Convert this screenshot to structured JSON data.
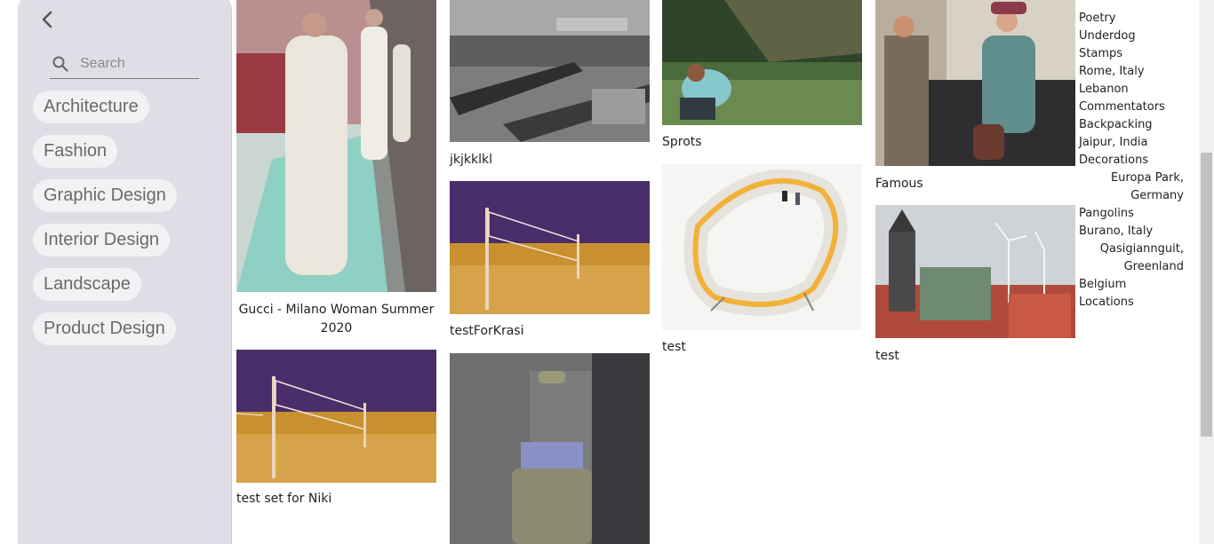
{
  "sidebar": {
    "search_placeholder": "Search",
    "categories": [
      {
        "label": "Architecture"
      },
      {
        "label": "Fashion"
      },
      {
        "label": "Graphic Design"
      },
      {
        "label": "Interior Design"
      },
      {
        "label": "Landscape"
      },
      {
        "label": "Product Design"
      }
    ]
  },
  "cards": {
    "gucci": {
      "caption": "Gucci - Milano Woman Summer 2020"
    },
    "test_set_niki": {
      "caption": "test set for Niki"
    },
    "jkjkklkl": {
      "caption": "jkjkklkl"
    },
    "testforkrasi": {
      "caption": "testForKrasi"
    },
    "sprots": {
      "caption": "Sprots"
    },
    "test_shelf": {
      "caption": "test"
    },
    "famous": {
      "caption": "Famous"
    },
    "test_town": {
      "caption": "test"
    }
  },
  "list": {
    "items": [
      "Poetry",
      "Underdog",
      "Stamps",
      "Rome, Italy",
      "Lebanon",
      "Commentators",
      "Backpacking",
      "Jaipur, India",
      "Decorations",
      "Europa Park,",
      "Germany",
      "Pangolins",
      "Burano, Italy",
      "Qasigiannguit,",
      "Greenland",
      "Belgium",
      "Locations"
    ]
  },
  "icons": {
    "back": "chevron-left-icon",
    "search": "search-icon"
  },
  "colors": {
    "sidebar_bg": "#e1dde6",
    "chip_bg": "#f3f1f4",
    "chip_text": "#6a6a6a"
  }
}
